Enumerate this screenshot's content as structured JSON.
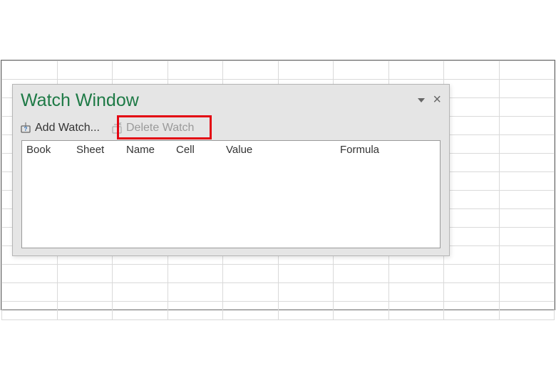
{
  "panel": {
    "title": "Watch Window",
    "toolbar": {
      "add_label": "Add Watch...",
      "delete_label": "Delete Watch"
    },
    "columns": {
      "book": "Book",
      "sheet": "Sheet",
      "name": "Name",
      "cell": "Cell",
      "value": "Value",
      "formula": "Formula"
    }
  }
}
